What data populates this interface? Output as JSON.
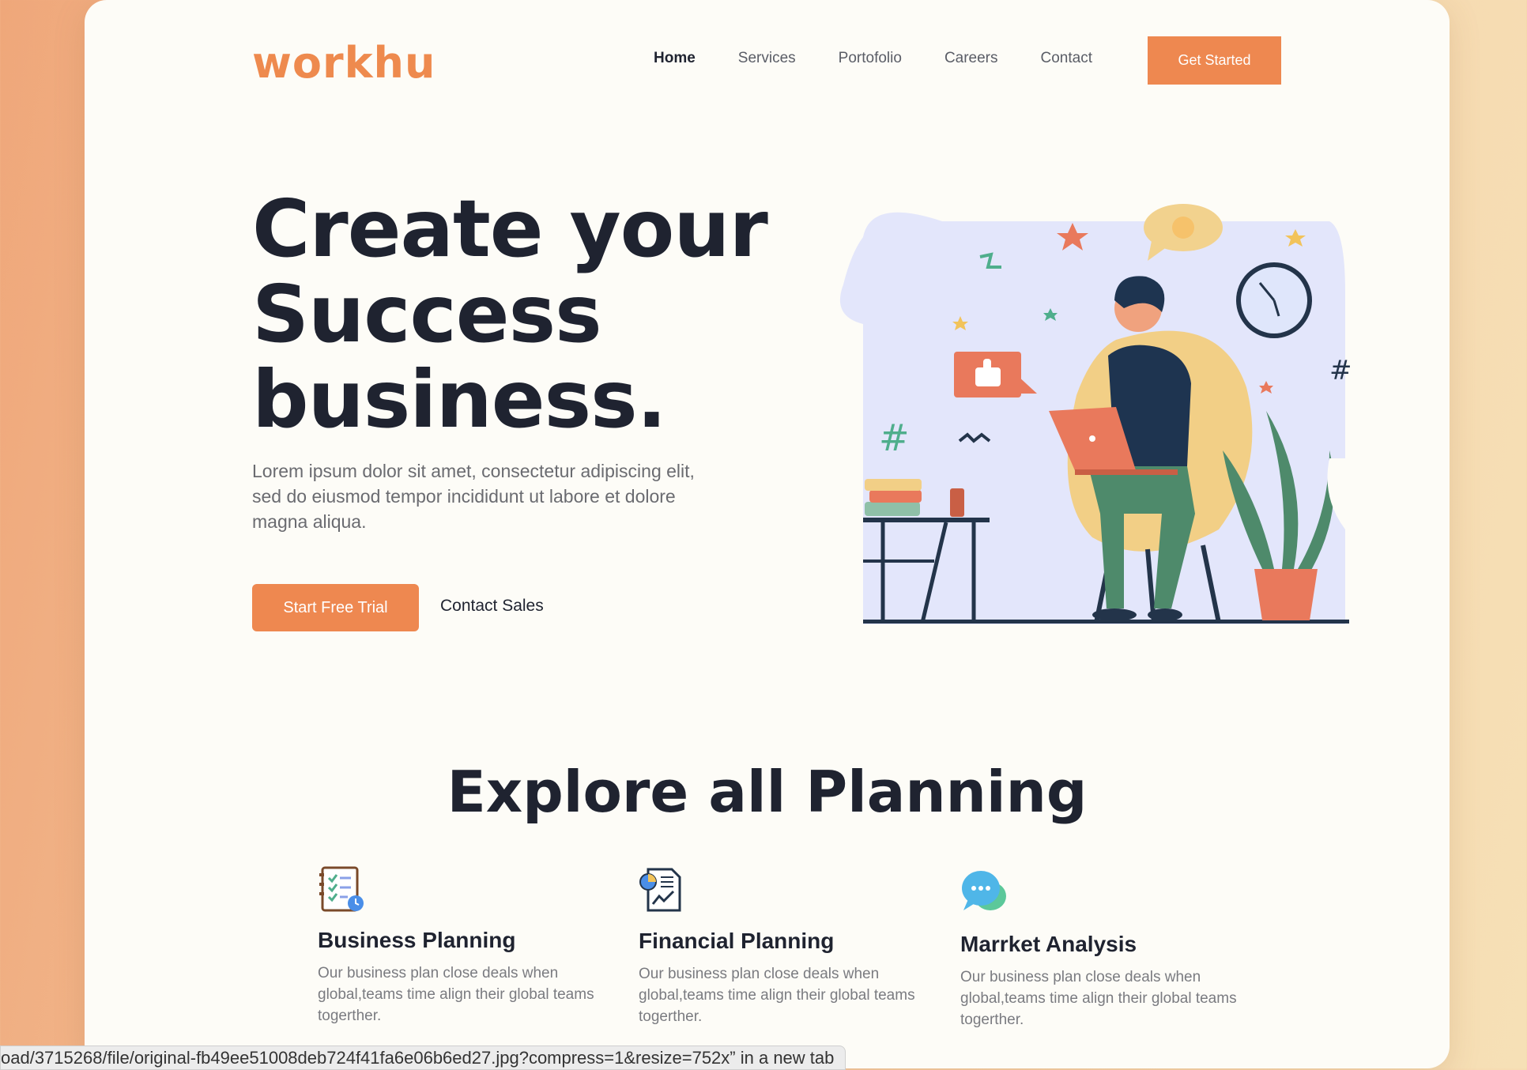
{
  "brand": {
    "logo_text": "workhu",
    "accent_color": "#ee8850"
  },
  "nav": {
    "items": [
      {
        "label": "Home",
        "active": true
      },
      {
        "label": "Services"
      },
      {
        "label": "Portofolio"
      },
      {
        "label": "Careers"
      },
      {
        "label": "Contact"
      }
    ],
    "cta_label": "Get Started"
  },
  "hero": {
    "title_lines": [
      "Create your",
      "Success",
      "business."
    ],
    "description": "Lorem ipsum dolor sit amet, consectetur adipiscing elit, sed do eiusmod tempor incididunt ut labore et dolore magna aliqua.",
    "primary_button": "Start Free Trial",
    "secondary_button": "Contact Sales"
  },
  "explore": {
    "title": "Explore all Planning",
    "features": [
      {
        "icon": "checklist-icon",
        "title": "Business Planning",
        "text": "Our business plan close deals when global,teams time align their global teams togerther."
      },
      {
        "icon": "report-chart-icon",
        "title": "Financial Planning",
        "text": "Our business plan close deals when global,teams time align their global teams togerther."
      },
      {
        "icon": "chat-bubbles-icon",
        "title": "Marrket Analysis",
        "text": "Our business plan close deals when global,teams time align their global teams togerther."
      }
    ]
  },
  "status_bar": {
    "text": "oad/3715268/file/original-fb49ee51008deb724f41fa6e06b6ed27.jpg?compress=1&resize=752x” in a new tab"
  }
}
